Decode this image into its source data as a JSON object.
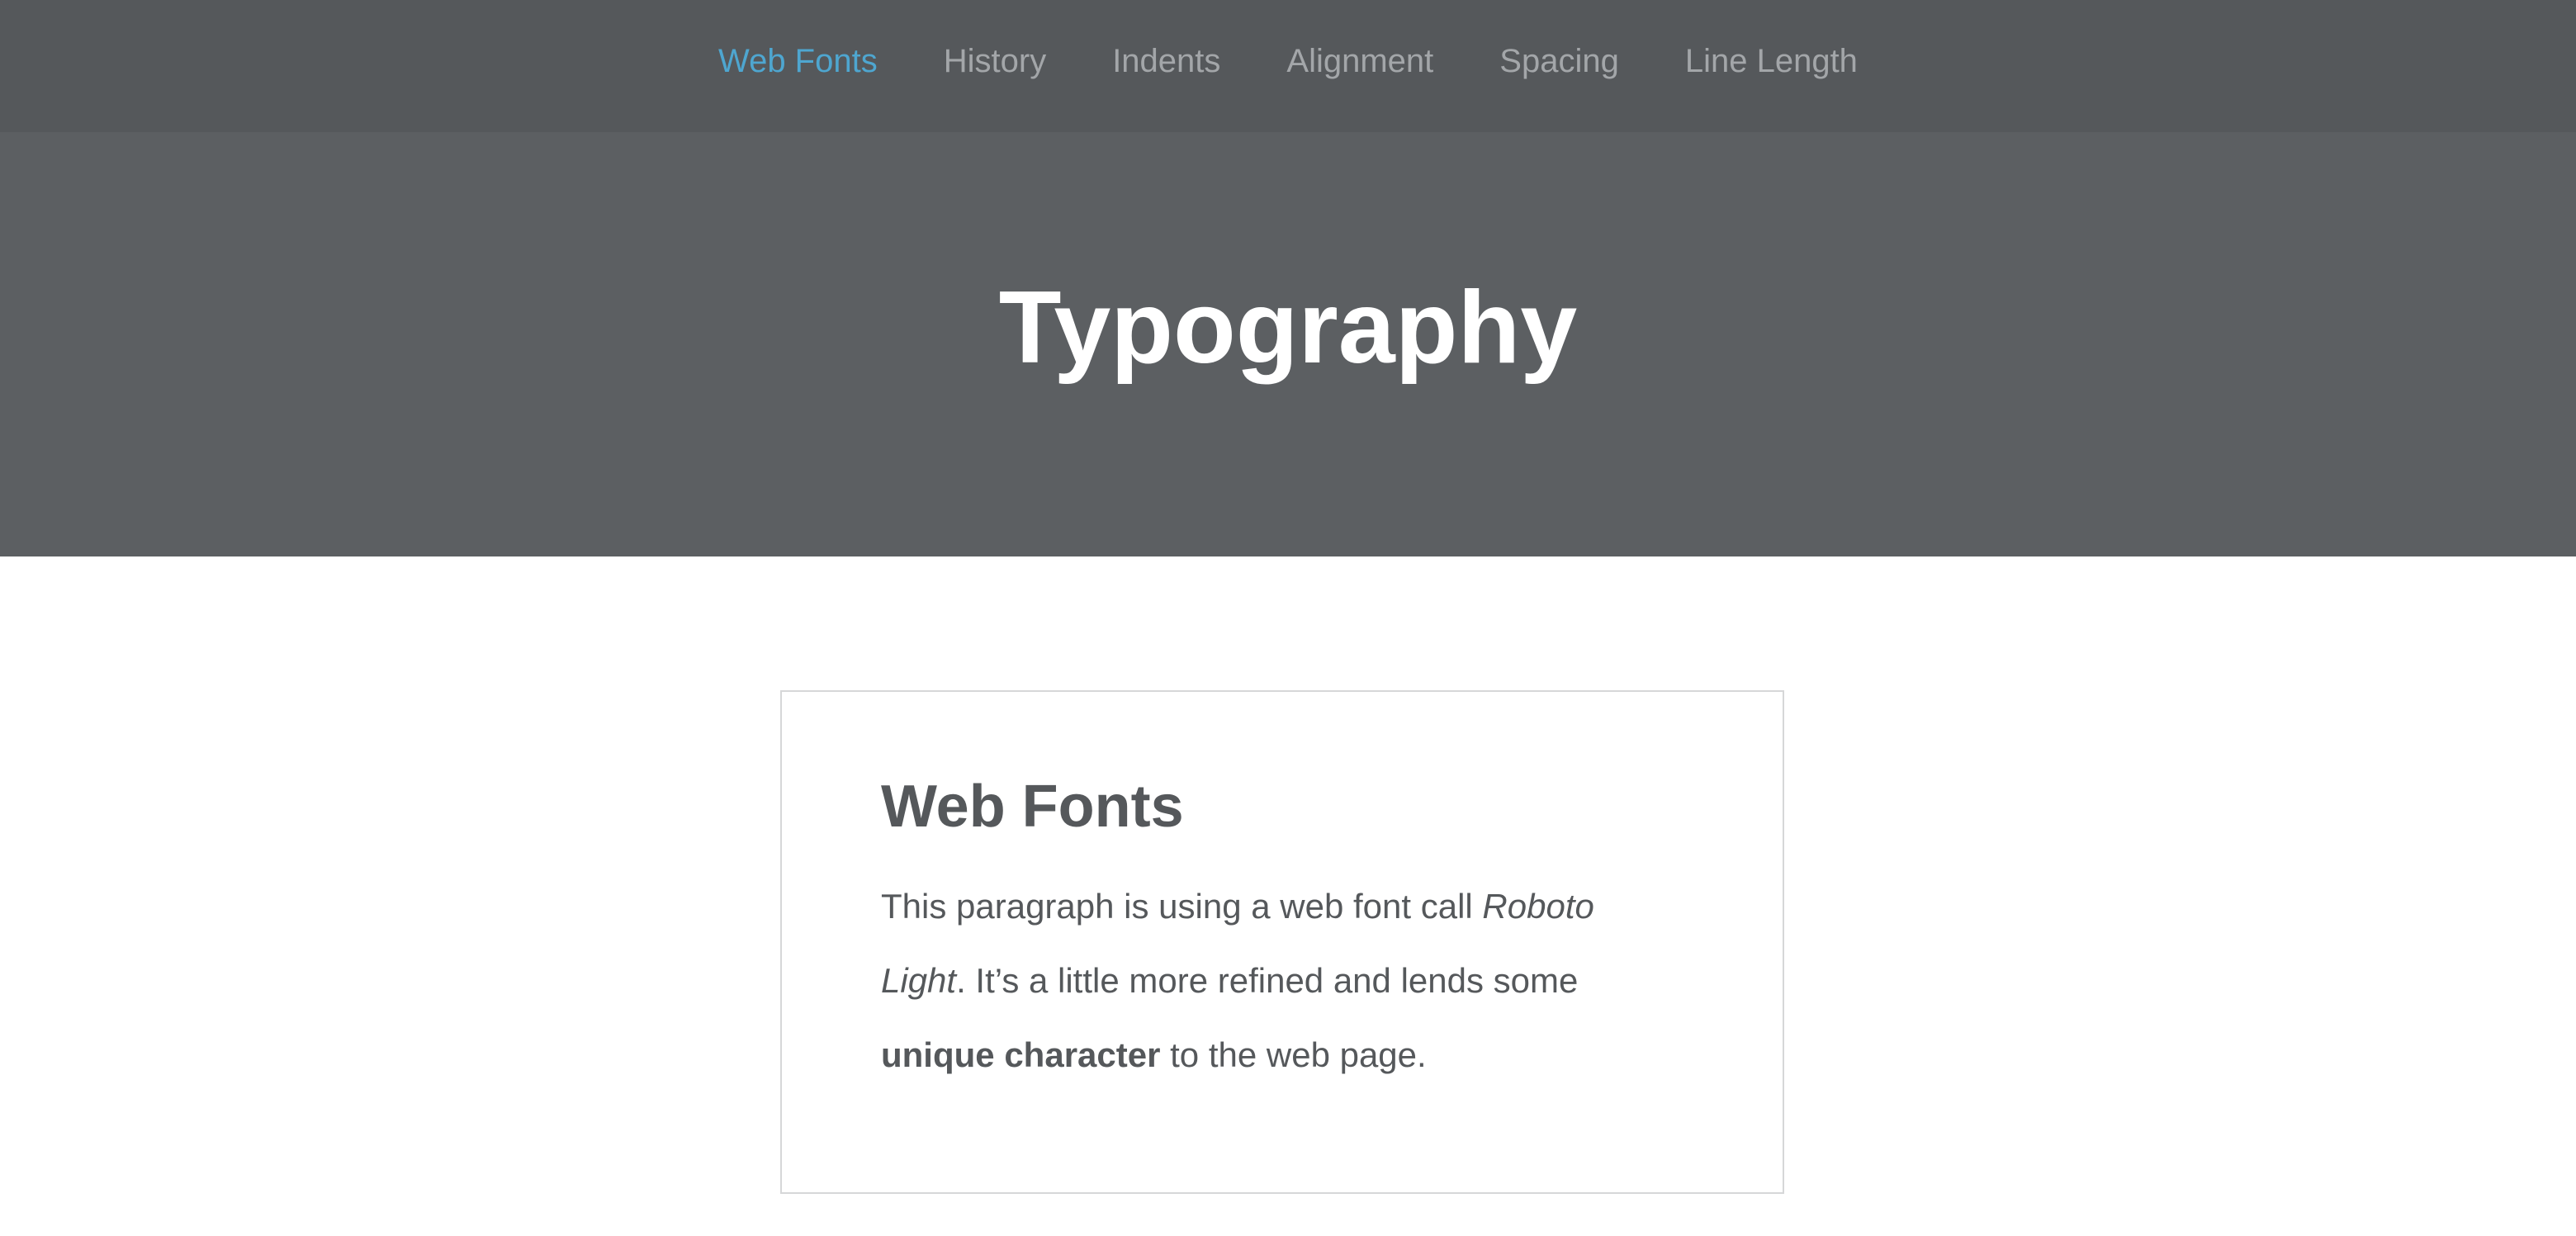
{
  "nav": {
    "items": [
      {
        "label": "Web Fonts",
        "active": true
      },
      {
        "label": "History",
        "active": false
      },
      {
        "label": "Indents",
        "active": false
      },
      {
        "label": "Alignment",
        "active": false
      },
      {
        "label": "Spacing",
        "active": false
      },
      {
        "label": "Line Length",
        "active": false
      }
    ]
  },
  "hero": {
    "title": "Typography"
  },
  "card": {
    "title": "Web Fonts",
    "paragraph": {
      "part1": "This paragraph is using a web font call ",
      "font_name": "Roboto Light",
      "part2": ". It’s a little more refined and lends some ",
      "emphasis": "unique character",
      "part3": " to the web page."
    }
  },
  "colors": {
    "nav_bg": "#55585b",
    "hero_bg": "#5c5f62",
    "accent": "#4ea6d0",
    "nav_text": "#a3a6a9",
    "body_text": "#55585b"
  }
}
